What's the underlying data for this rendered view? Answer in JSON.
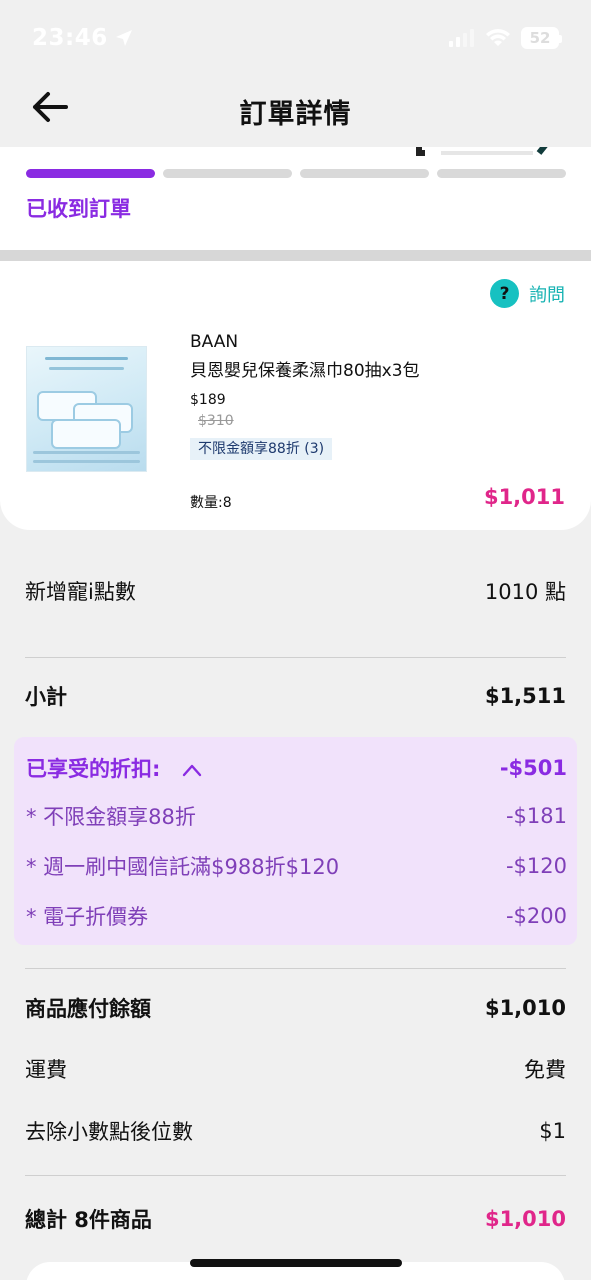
{
  "status_bar": {
    "time": "23:46",
    "battery": "52"
  },
  "header": {
    "title": "訂單詳情"
  },
  "progress": {
    "steps_total": 4,
    "active_step": 1,
    "current_label": "已收到訂單"
  },
  "inquiry": {
    "icon_text": "?",
    "label": "詢問"
  },
  "product": {
    "brand": "BAAN",
    "name": "貝恩嬰兒保養柔濕巾80抽x3包",
    "price": "$189",
    "original_price": "$310",
    "promo_tag": "不限金額享88折 (3)",
    "quantity": "數量:8",
    "line_total": "$1,011"
  },
  "summary": {
    "points": {
      "label": "新增寵i點數",
      "value": "1010 點"
    },
    "subtotal": {
      "label": "小計",
      "value": "$1,511"
    },
    "discounts": {
      "header_label": "已享受的折扣:",
      "header_value": "-$501",
      "items": [
        {
          "label": "* 不限金額享88折",
          "value": "-$181"
        },
        {
          "label": "* 週一刷中國信託滿$988折$120",
          "value": "-$120"
        },
        {
          "label": "* 電子折價券",
          "value": "-$200"
        }
      ]
    },
    "payable": {
      "label": "商品應付餘額",
      "value": "$1,010"
    },
    "shipping": {
      "label": "運費",
      "value": "免費"
    },
    "rounding": {
      "label": "去除小數點後位數",
      "value": "$1"
    },
    "total": {
      "label": "總計 8件商品",
      "value": "$1,010"
    }
  },
  "colors": {
    "accent_purple": "#8a2be2",
    "pink_total": "#e0268a",
    "teal": "#17c1c1",
    "discount_bg": "#f1e2fb"
  }
}
